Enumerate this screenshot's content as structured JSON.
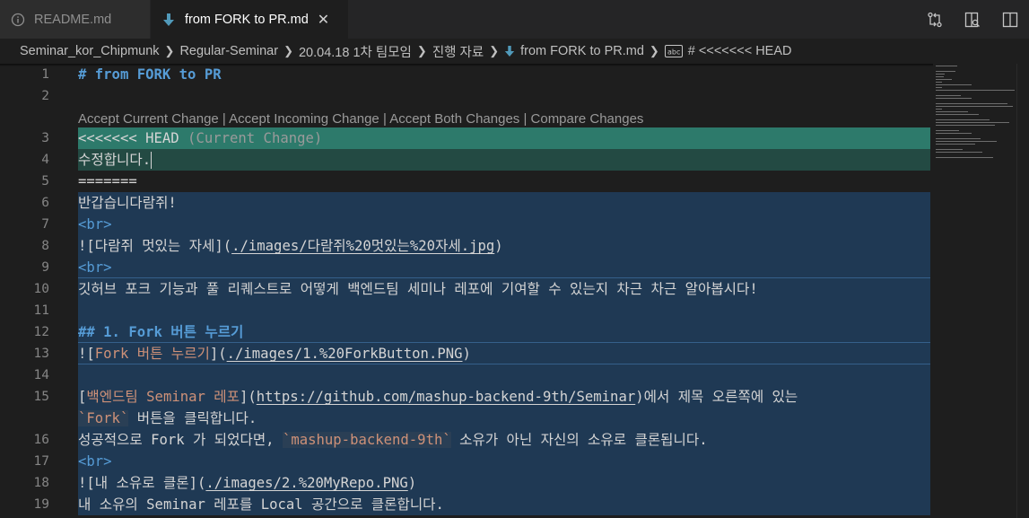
{
  "tabs": [
    {
      "label": "README.md",
      "icon": "info-icon",
      "active": false
    },
    {
      "label": "from FORK to PR.md",
      "icon": "download-arrow-icon",
      "active": true,
      "close": "✕"
    }
  ],
  "tab_actions": [
    "compare-changes-icon",
    "open-preview-icon",
    "split-editor-icon"
  ],
  "breadcrumb": {
    "items": [
      "Seminar_kor_Chipmunk",
      "Regular-Seminar",
      "20.04.18 1차 팀모임",
      "진행 자료",
      "from FORK to PR.md",
      "# <<<<<<< HEAD"
    ]
  },
  "codelens": {
    "accept_current": "Accept Current Change",
    "accept_incoming": "Accept Incoming Change",
    "accept_both": "Accept Both Changes",
    "compare": "Compare Changes",
    "divider": " | "
  },
  "lines": {
    "l1": "# from FORK to PR",
    "l3_marker": "<<<<<<< HEAD",
    "l3_label": " (Current Change)",
    "l4": "수정합니다.",
    "l5": "=======",
    "l6": "반갑습니다람쥐!",
    "br": "<br>",
    "l8_a": "![다람쥐 멋있는 자세](",
    "l8_url": "./images/다람쥐%20멋있는%20자세.jpg",
    "l8_b": ")",
    "l10": "깃허브 포크 기능과 풀 리퀘스트로 어떻게 백엔드팀 세미나 레포에 기여할 수 있는지 차근 차근 알아봅시다!",
    "l12": "## 1. Fork 버튼 누르기",
    "l13_a": "![",
    "l13_alt": "Fork 버튼 누르기",
    "l13_b": "](",
    "l13_url": "./images/1.%20ForkButton.PNG",
    "l13_c": ")",
    "l15_a": "[",
    "l15_text": "백엔드팀 Seminar 레포",
    "l15_b": "](",
    "l15_url": "https://github.com/mashup-backend-9th/Seminar",
    "l15_c": ")에서 제목 오른쪽에 있는",
    "l15_wrap_code": "`Fork`",
    "l15_wrap_rest": " 버튼을 클릭합니다.",
    "l16_a": "성공적으로 Fork 가 되었다면, ",
    "l16_code": "`mashup-backend-9th`",
    "l16_b": " 소유가 아닌 자신의 소유로 클론됩니다.",
    "l18_a": "![내 소유로 클론](",
    "l18_url": "./images/2.%20MyRepo.PNG",
    "l18_b": ")",
    "l19": "내 소유의 Seminar 레포를 Local 공간으로 클론합니다."
  },
  "line_numbers": [
    "1",
    "2",
    "3",
    "4",
    "5",
    "6",
    "7",
    "8",
    "9",
    "10",
    "11",
    "12",
    "13",
    "14",
    "15",
    "16",
    "17",
    "18",
    "19"
  ],
  "colors": {
    "current_header": "#2d7a6b",
    "current_body": "#234a43",
    "incoming_body": "#1f3954",
    "heading": "#569cd6",
    "link_text": "#ce9178"
  }
}
